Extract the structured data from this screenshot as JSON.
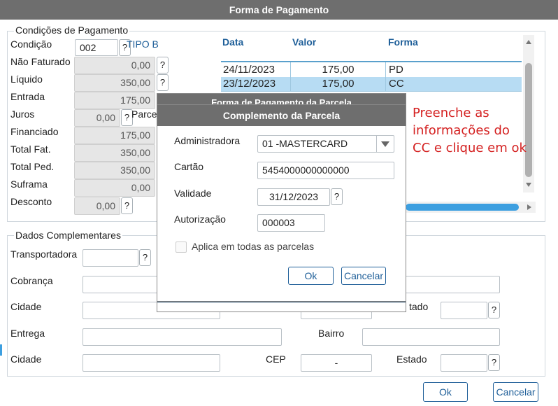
{
  "window_title": "Forma de Pagamento",
  "condicoes": {
    "legend": "Condições de Pagamento",
    "condicao": {
      "label": "Condição",
      "value": "002",
      "tipo": "TIPO B"
    },
    "nao_faturado": {
      "label": "Não Faturado",
      "value": "0,00"
    },
    "liquido": {
      "label": "Líquido",
      "value": "350,00"
    },
    "entrada": {
      "label": "Entrada",
      "value": "175,00"
    },
    "juros": {
      "label": "Juros",
      "value": "0,00",
      "parcelas_label": "Parce"
    },
    "financiado": {
      "label": "Financiado",
      "value": "175,00"
    },
    "total_fat": {
      "label": "Total Fat.",
      "value": "350,00"
    },
    "total_ped": {
      "label": "Total Ped.",
      "value": "350,00"
    },
    "suframa": {
      "label": "Suframa",
      "value": "0,00"
    },
    "desconto": {
      "label": "Desconto",
      "value": "0,00"
    }
  },
  "parcelas_table": {
    "headers": {
      "data": "Data",
      "valor": "Valor",
      "forma": "Forma"
    },
    "rows": [
      {
        "data": "24/11/2023",
        "valor": "175,00",
        "forma": "PD"
      },
      {
        "data": "23/12/2023",
        "valor": "175,00",
        "forma": "CC"
      }
    ]
  },
  "dados": {
    "legend": "Dados Complementares",
    "transportadora": "Transportadora",
    "cobranca": "Cobrança",
    "cidade1": "Cidade",
    "estado1": "tado",
    "entrega": "Entrega",
    "bairro": "Bairro",
    "cidade2": "Cidade",
    "cep_label": "CEP",
    "cep_value": "-",
    "estado2": "Estado"
  },
  "question_mark": "?",
  "footer": {
    "ok": "Ok",
    "cancelar": "Cancelar"
  },
  "back_dialog_title": "Forma de Pagamento da Parcela",
  "dialog": {
    "title": "Complemento da Parcela",
    "administradora": {
      "label": "Administradora",
      "value": "01 -MASTERCARD"
    },
    "cartao": {
      "label": "Cartão",
      "value": "5454000000000000"
    },
    "validade": {
      "label": "Validade",
      "value": "31/12/2023"
    },
    "autorizacao": {
      "label": "Autorização",
      "value": "000003"
    },
    "aplica": {
      "label": "Aplica em todas as parcelas",
      "checked": false
    },
    "ok": "Ok",
    "cancelar": "Cancelar"
  },
  "annotation": {
    "line1": "Preenche as",
    "line2": "informações do",
    "line3": "CC e clique em ok"
  },
  "colors": {
    "title_bar": "#6e6e6e",
    "accent": "#1f5f99",
    "selected_row": "#b7dcf3",
    "annotation": "#d42020"
  }
}
